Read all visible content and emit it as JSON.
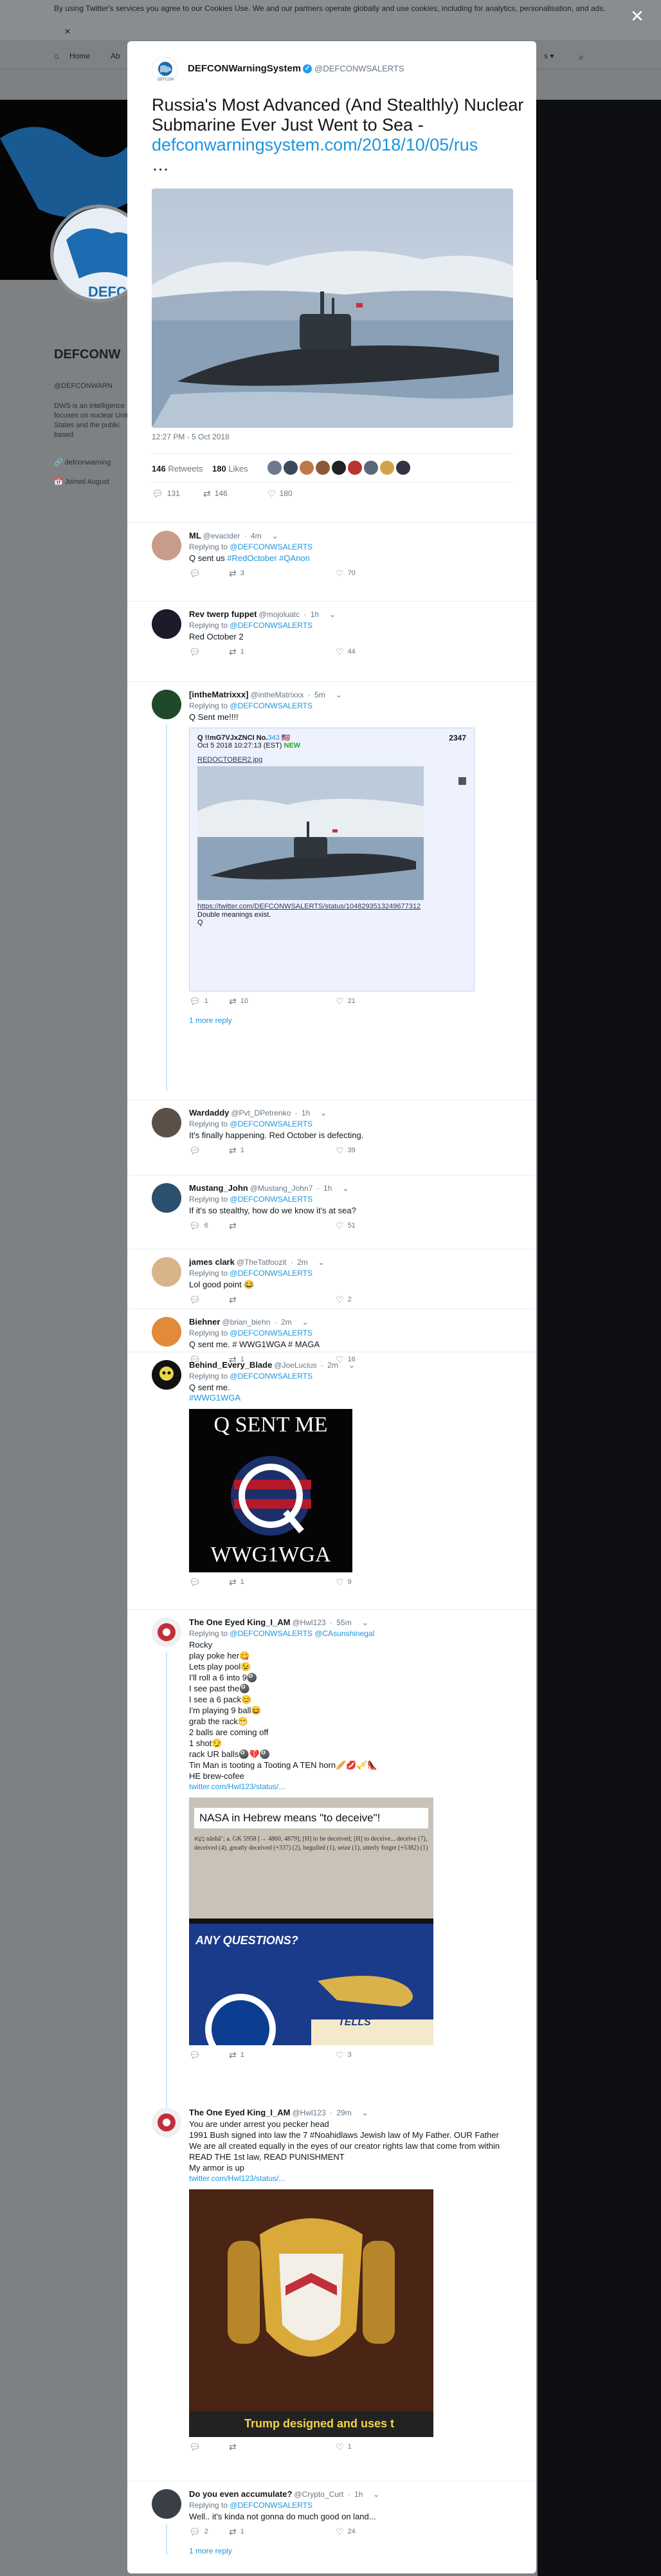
{
  "background": {
    "cookie_text": "By using Twitter's services you agree to our Cookies Use. We and our partners operate globally and use cookies, including for analytics, personalisation, and ads.",
    "cookie_close": "✕",
    "nav": {
      "home": "Home",
      "about": "Ab",
      "right_partial": "s ▾"
    },
    "profile_name": "DEFCONW",
    "profile_handle": "@DEFCONWARN",
    "profile_bio": "DWS is an intelligence focuses on nuclear United States and the public based",
    "profile_link": "defconwarning",
    "profile_joined": "Joined August",
    "overlay_close": "✕"
  },
  "tweet": {
    "author_name": "DEFCONWarningSystem",
    "author_handle": "@DEFCONWSALERTS",
    "title_text": "Russia's Most Advanced (And Stealthly) Nuclear Submarine Ever Just Went to Sea -",
    "title_link": "defconwarningsystem.com/2018/10/05/rus",
    "title_ellipsis": "…",
    "timestamp": "12:27 PM - 5 Oct 2018",
    "retweets": "146",
    "retweets_label": "Retweets",
    "likes": "180",
    "likes_label": "Likes",
    "reply_count": "131",
    "retweet_count": "146",
    "like_count": "180"
  },
  "replies": [
    {
      "name": "ML",
      "handle": "@evacider",
      "time": "4m",
      "replying_prefix": "Replying to",
      "replying_to": "@DEFCONWSALERTS",
      "text": "Q sent us ",
      "tags": "#RedOctober #QAnon",
      "reply": "",
      "retweet": "3",
      "like": "70"
    },
    {
      "name": "Rev twerp fuppet",
      "handle": "@mojoluatc",
      "time": "1h",
      "replying_prefix": "Replying to",
      "replying_to": "@DEFCONWSALERTS",
      "text": "Red October 2",
      "reply": "",
      "retweet": "1",
      "like": "44"
    },
    {
      "name": "[intheMatrixxx]",
      "handle": "@intheMatrixxx",
      "time": "5m",
      "replying_prefix": "Replying to",
      "replying_to": "@DEFCONWSALERTS",
      "text": "Q Sent me!!!!",
      "reply": "1",
      "retweet": "10",
      "like": "21"
    },
    {
      "name": "Wardaddy",
      "handle": "@Pvt_DPetrenko",
      "time": "1h",
      "replying_prefix": "Replying to",
      "replying_to": "@DEFCONWSALERTS",
      "text": "It's finally happening. Red October is defecting.",
      "reply": "",
      "retweet": "1",
      "like": "39"
    },
    {
      "name": "Mustang_John",
      "handle": "@Mustang_John7",
      "time": "1h",
      "replying_prefix": "Replying to",
      "replying_to": "@DEFCONWSALERTS",
      "text": "If it's so stealthy,  how do we know it's at sea?",
      "reply": "6",
      "retweet": "",
      "like": "51"
    },
    {
      "name": "james clark",
      "handle": "@TheTatfoozit",
      "time": "2m",
      "replying_prefix": "Replying to",
      "replying_to": "@DEFCONWSALERTS",
      "text": "Lol good point 😂",
      "reply": "",
      "retweet": "",
      "like": "2"
    },
    {
      "name": "Biehner",
      "handle": "@brian_biehn",
      "time": "2m",
      "replying_prefix": "Replying to",
      "replying_to": "@DEFCONWSALERTS",
      "text": "Q sent me. # WWG1WGA # MAGA",
      "reply": "",
      "retweet": "1",
      "like": "16"
    },
    {
      "name": "Behind_Every_Blade",
      "handle": "@JoeLucius",
      "time": "2m",
      "replying_prefix": "Replying to",
      "replying_to": "@DEFCONWSALERTS",
      "text": "Q sent me.",
      "tags": "#WWG1WGA",
      "reply": "",
      "retweet": "1",
      "like": "9"
    },
    {
      "name": "The One Eyed King_I_AM",
      "handle": "@Hwl123",
      "time": "55m",
      "replying_prefix": "Replying to",
      "replying_to": "@DEFCONWSALERTS @CAsunshinegal",
      "text": "Rocky\nplay poke her😋\nLets play pool😉\nI'll roll a 6 into 9🎱\nI see past the🎱\nI see a 6 pack😊\nI'm playing 9 ball😆\ngrab the rack😁\n2 balls are coming off\n1 shot😏\nrack UR balls🎱💔🎱\nTin Man is tooting a Tooting A TEN horn🥖💋🎺👠\nHE brew-cofee",
      "link": "twitter.com/Hwl123/status/...",
      "reply": "",
      "retweet": "1",
      "like": "3"
    },
    {
      "name": "The One Eyed King_I_AM",
      "handle": "@Hwl123",
      "time": "29m",
      "text": "You are under arrest you pecker head\n1991 Bush signed into law the 7 #Noahidlaws Jewish law of My Father. OUR Father We are all created equally in the eyes of our creator rights law that come from within READ  THE 1st law, READ PUNISHMENT\nMy armor is up",
      "link": "twitter.com/Hwl123/status/...",
      "reply": "",
      "retweet": "",
      "like": "1"
    },
    {
      "name": "Do you even accumulate?",
      "handle": "@Crypto_Curt",
      "time": "1h",
      "replying_prefix": "Replying to",
      "replying_to": "@DEFCONWSALERTS",
      "text": "Well.. it's kinda not gonna do much good on land...",
      "reply": "2",
      "retweet": "1",
      "like": "24"
    }
  ],
  "embedded_post": {
    "header": "Q !!mG7VJxZNCI No.",
    "post_no": "343",
    "flag": "🇺🇸",
    "id_num": "2347",
    "date": "Oct 5 2018 10:27:13 (EST)",
    "new_label": "NEW",
    "filename": "REDOCTOBER2.jpg",
    "url": "https://twitter.com/DEFCONWSALERTS/status/1048293513249677312",
    "line1": "Double meanings exist.",
    "line2": "Q"
  },
  "qsent_image": {
    "top": "Q SENT ME",
    "bottom": "WWG1WGA"
  },
  "nasa_image": {
    "headline": "NASA in Hebrew means \"to deceive\"!",
    "body": "נָשָׁא nâshâʼ; a. GK 5958 [→ 4860, 4879]; [H] to be deceived; [H] to deceive... deceive (7), deceived (4), greatly deceived (+337) (2), beguiled (1), seize (1), utterly forget (+5382) (1)",
    "question": "ANY QUESTIONS?",
    "snake": "NOTHING NASA TELLS"
  },
  "crest_image": {
    "caption": "Trump designed and uses t"
  },
  "more_reply_1": "1 more reply",
  "more_reply_2": "1 more reply"
}
